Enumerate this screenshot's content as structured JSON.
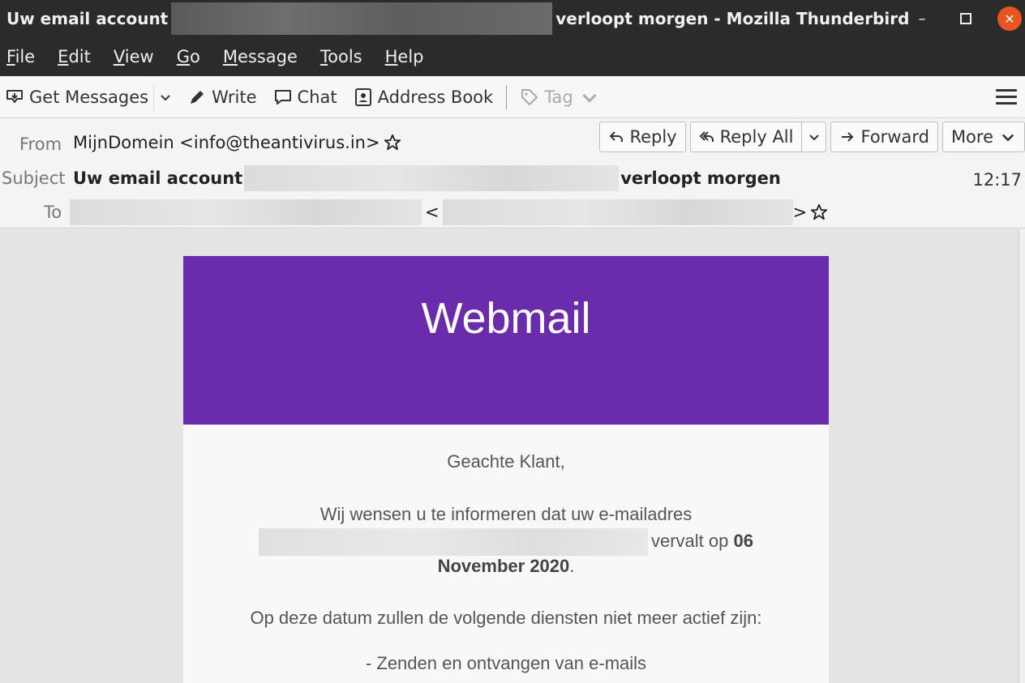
{
  "window": {
    "title_prefix": "Uw email account",
    "title_suffix": "verloopt morgen - Mozilla Thunderbird",
    "minimize": "–",
    "maximize": "□",
    "close": "✕"
  },
  "menu": {
    "file": {
      "letter": "F",
      "rest": "ile"
    },
    "edit": {
      "letter": "E",
      "rest": "dit"
    },
    "view": {
      "letter": "V",
      "rest": "iew"
    },
    "go": {
      "letter": "G",
      "rest": "o"
    },
    "message": {
      "letter": "M",
      "rest": "essage"
    },
    "tools": {
      "letter": "T",
      "rest": "ools"
    },
    "help": {
      "letter": "H",
      "rest": "elp"
    }
  },
  "toolbar": {
    "get_messages": "Get Messages",
    "write": "Write",
    "chat": "Chat",
    "address_book": "Address Book",
    "tag": "Tag"
  },
  "header": {
    "from_label": "From",
    "from_value": "MijnDomein <info@theantivirus.in>",
    "subject_label": "Subject",
    "subject_prefix": "Uw email account",
    "subject_suffix": "verloopt morgen",
    "to_label": "To",
    "to_open": "<",
    "to_close": ">",
    "time": "12:17",
    "reply": "Reply",
    "reply_all": "Reply All",
    "forward": "Forward",
    "more": "More"
  },
  "message": {
    "banner_title": "Webmail",
    "greeting": "Geachte Klant,",
    "line1": "Wij wensen u te informeren dat uw e-mailadres",
    "line2_text": "vervalt op ",
    "line2_bold": "06",
    "line3_bold": "November 2020",
    "line3_end": ".",
    "line4": "Op deze datum zullen de volgende diensten niet meer actief zijn:",
    "line5": "- Zenden en ontvangen van e-mails"
  },
  "colors": {
    "banner": "#6a2bad",
    "close_button": "#e95420"
  }
}
